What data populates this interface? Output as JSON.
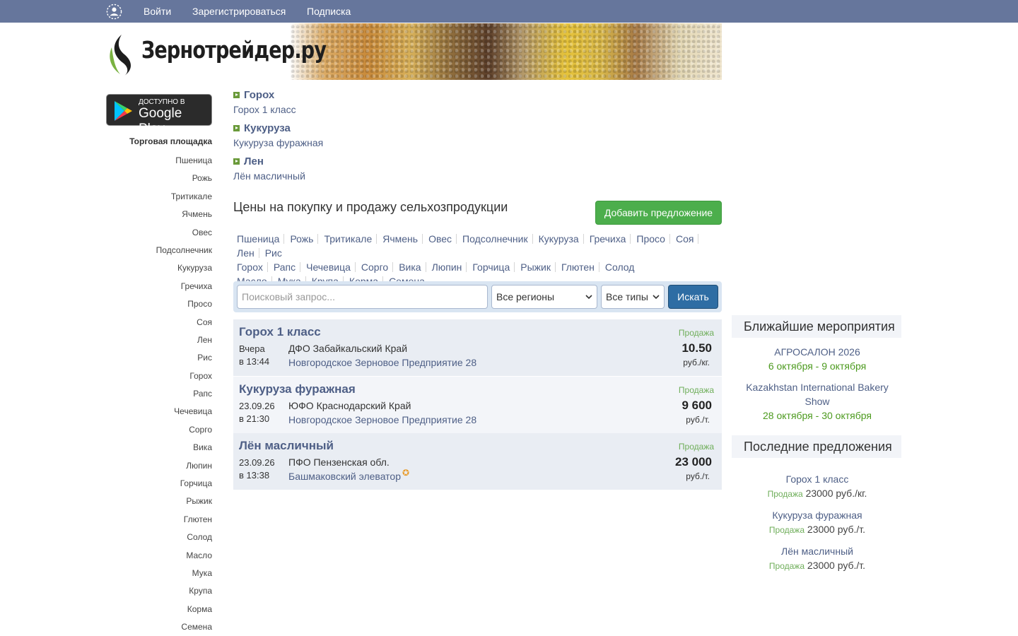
{
  "topbar": {
    "login": "Войти",
    "register": "Зарегистрироваться",
    "subscribe": "Подписка"
  },
  "banner": {
    "logo_text": "Зернотрейдер.ру"
  },
  "google_play": {
    "small": "Доступно в",
    "big": "Google Play"
  },
  "sidebar": {
    "title": "Торговая площадка",
    "items": [
      "Пшеница",
      "Рожь",
      "Тритикале",
      "Ячмень",
      "Овес",
      "Подсолнечник",
      "Кукуруза",
      "Гречиха",
      "Просо",
      "Соя",
      "Лен",
      "Рис",
      "Горох",
      "Рапс",
      "Чечевица",
      "Сорго",
      "Вика",
      "Люпин",
      "Горчица",
      "Рыжик",
      "Глютен",
      "Солод",
      "Масло",
      "Мука",
      "Крупа",
      "Корма",
      "Семена"
    ]
  },
  "categories": [
    {
      "name": "Горох",
      "sub": "Горох 1 класс"
    },
    {
      "name": "Кукуруза",
      "sub": "Кукуруза фуражная"
    },
    {
      "name": "Лен",
      "sub": "Лён масличный"
    }
  ],
  "main": {
    "title": "Цены на покупку и продажу сельхозпродукции",
    "add_button": "Добавить предложение",
    "tags": [
      "Пшеница",
      "Рожь",
      "Тритикале",
      "Ячмень",
      "Овес",
      "Подсолнечник",
      "Кукуруза",
      "Гречиха",
      "Просо",
      "Соя",
      "Лен",
      "Рис",
      "Горох",
      "Рапс",
      "Чечевица",
      "Сорго",
      "Вика",
      "Люпин",
      "Горчица",
      "Рыжик",
      "Глютен",
      "Солод",
      "Масло",
      "Мука",
      "Крупа",
      "Корма",
      "Семена"
    ]
  },
  "search": {
    "placeholder": "Поисковый запрос...",
    "region": "Все регионы",
    "type": "Все типы",
    "button": "Искать"
  },
  "offers": [
    {
      "title": "Горох 1 класс",
      "date": "Вчера",
      "time": "в 13:44",
      "region": "ДФО Забайкальский Край",
      "company": "Новгородское Зерновое Предприятие 28",
      "type": "Продажа",
      "price": "10.50",
      "unit": "руб./кг.",
      "star": false
    },
    {
      "title": "Кукуруза фуражная",
      "date": "23.09.26",
      "time": "в 21:30",
      "region": "ЮФО Краснодарский Край",
      "company": "Новгородское Зерновое Предприятие 28",
      "type": "Продажа",
      "price": "9 600",
      "unit": "руб./т.",
      "star": false
    },
    {
      "title": "Лён масличный",
      "date": "23.09.26",
      "time": "в 13:38",
      "region": "ПФО Пензенская обл.",
      "company": "Башмаковский элеватор",
      "type": "Продажа",
      "price": "23 000",
      "unit": "руб./т.",
      "star": true,
      "star_glyph": "✪"
    }
  ],
  "right": {
    "events_title": "Ближайшие мероприятия",
    "events": [
      {
        "name": "АГРОСАЛОН 2026",
        "date": "6 октября - 9 октября"
      },
      {
        "name": "Kazakhstan International Bakery Show",
        "date": "28 октября - 30 октября"
      }
    ],
    "last_title": "Последние предложения",
    "last_offers": [
      {
        "name": "Горох 1 класс",
        "type": "Продажа",
        "price": "23000 руб./кг."
      },
      {
        "name": "Кукуруза фуражная",
        "type": "Продажа",
        "price": "23000 руб./т."
      },
      {
        "name": "Лён масличный",
        "type": "Продажа",
        "price": "23000 руб./т."
      }
    ]
  },
  "colors": {
    "topbar": "#66769c",
    "link": "#4e5f86",
    "add_button": "#4cae4c",
    "search_button": "#2e6da4",
    "sale_label": "#6fae5a",
    "event_date": "#4c9a1e"
  }
}
